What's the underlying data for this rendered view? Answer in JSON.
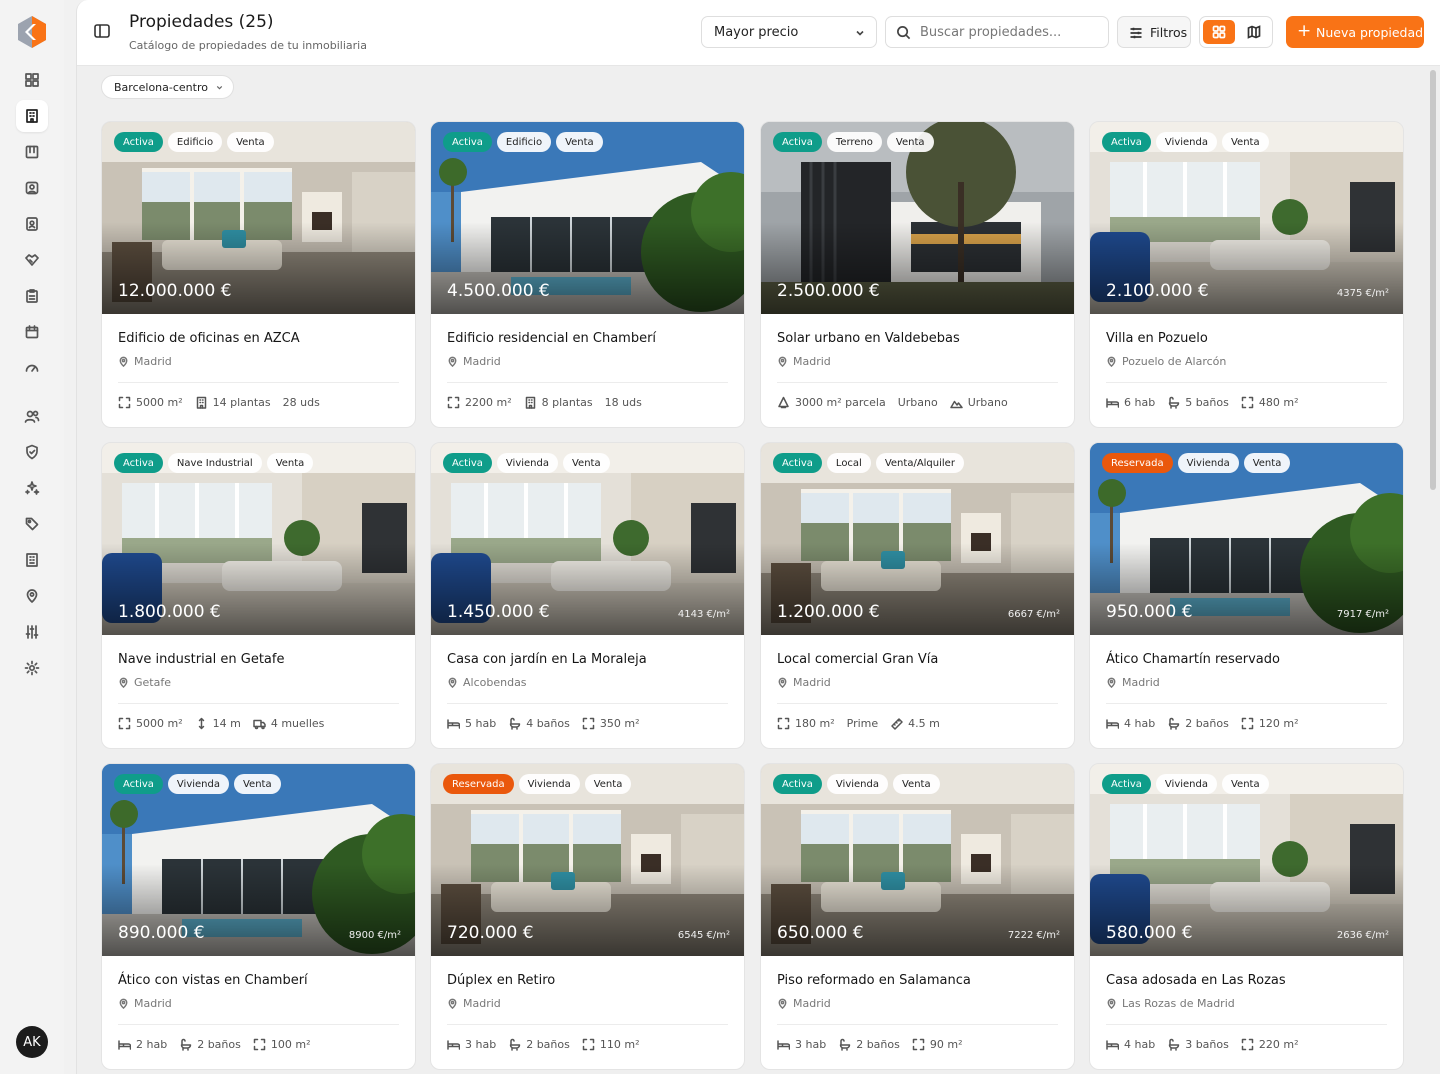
{
  "header": {
    "title": "Propiedades (25)",
    "subtitle": "Catálogo de propiedades de tu inmobiliaria",
    "sort_value": "Mayor precio",
    "search_placeholder": "Buscar propiedades...",
    "filters_label": "Filtros",
    "new_label": "Nueva propiedad"
  },
  "filters": {
    "location": "Barcelona-centro"
  },
  "user": {
    "initials": "AK"
  },
  "colors": {
    "accent": "#f97316",
    "active": "#0f9d8a",
    "reserved": "#ea580c"
  },
  "cards": [
    {
      "status": "Activa",
      "type": "Edificio",
      "op": "Venta",
      "price": "12.000.000 €",
      "per_m2": "",
      "title": "Edificio de oficinas en AZCA",
      "city": "Madrid",
      "scene": "interior",
      "specs": [
        {
          "icon": "area-icon",
          "text": "5000 m²"
        },
        {
          "icon": "building-icon",
          "text": "14 plantas"
        },
        {
          "icon": "",
          "text": "28 uds"
        }
      ]
    },
    {
      "status": "Activa",
      "type": "Edificio",
      "op": "Venta",
      "price": "4.500.000 €",
      "per_m2": "",
      "title": "Edificio residencial en Chamberí",
      "city": "Madrid",
      "scene": "villa",
      "specs": [
        {
          "icon": "area-icon",
          "text": "2200 m²"
        },
        {
          "icon": "building-icon",
          "text": "8 plantas"
        },
        {
          "icon": "",
          "text": "18 uds"
        }
      ]
    },
    {
      "status": "Activa",
      "type": "Terreno",
      "op": "Venta",
      "price": "2.500.000 €",
      "per_m2": "",
      "title": "Solar urbano en Valdebebas",
      "city": "Madrid",
      "scene": "modern",
      "specs": [
        {
          "icon": "parcel-icon",
          "text": "3000 m² parcela"
        },
        {
          "icon": "",
          "text": "Urbano"
        },
        {
          "icon": "mountain-icon",
          "text": "Urbano"
        }
      ]
    },
    {
      "status": "Activa",
      "type": "Vivienda",
      "op": "Venta",
      "price": "2.100.000 €",
      "per_m2": "4375 €/m²",
      "title": "Villa en Pozuelo",
      "city": "Pozuelo de Alarcón",
      "scene": "living",
      "specs": [
        {
          "icon": "bed-icon",
          "text": "6 hab"
        },
        {
          "icon": "bath-icon",
          "text": "5 baños"
        },
        {
          "icon": "area-icon",
          "text": "480 m²"
        }
      ]
    },
    {
      "status": "Activa",
      "type": "Nave Industrial",
      "op": "Venta",
      "price": "1.800.000 €",
      "per_m2": "",
      "title": "Nave industrial en Getafe",
      "city": "Getafe",
      "scene": "living",
      "specs": [
        {
          "icon": "area-icon",
          "text": "5000 m²"
        },
        {
          "icon": "height-icon",
          "text": "14 m"
        },
        {
          "icon": "truck-icon",
          "text": "4 muelles"
        }
      ]
    },
    {
      "status": "Activa",
      "type": "Vivienda",
      "op": "Venta",
      "price": "1.450.000 €",
      "per_m2": "4143 €/m²",
      "title": "Casa con jardín en La Moraleja",
      "city": "Alcobendas",
      "scene": "living",
      "specs": [
        {
          "icon": "bed-icon",
          "text": "5 hab"
        },
        {
          "icon": "bath-icon",
          "text": "4 baños"
        },
        {
          "icon": "area-icon",
          "text": "350 m²"
        }
      ]
    },
    {
      "status": "Activa",
      "type": "Local",
      "op": "Venta/Alquiler",
      "price": "1.200.000 €",
      "per_m2": "6667 €/m²",
      "title": "Local comercial Gran Vía",
      "city": "Madrid",
      "scene": "interior",
      "specs": [
        {
          "icon": "area-icon",
          "text": "180 m²"
        },
        {
          "icon": "",
          "text": "Prime"
        },
        {
          "icon": "ruler-icon",
          "text": "4.5 m"
        }
      ]
    },
    {
      "status": "Reservada",
      "type": "Vivienda",
      "op": "Venta",
      "price": "950.000 €",
      "per_m2": "7917 €/m²",
      "title": "Ático Chamartín reservado",
      "city": "Madrid",
      "scene": "villa",
      "specs": [
        {
          "icon": "bed-icon",
          "text": "4 hab"
        },
        {
          "icon": "bath-icon",
          "text": "2 baños"
        },
        {
          "icon": "area-icon",
          "text": "120 m²"
        }
      ]
    },
    {
      "status": "Activa",
      "type": "Vivienda",
      "op": "Venta",
      "price": "890.000 €",
      "per_m2": "8900 €/m²",
      "title": "Ático con vistas en Chamberí",
      "city": "Madrid",
      "scene": "villa",
      "specs": [
        {
          "icon": "bed-icon",
          "text": "2 hab"
        },
        {
          "icon": "bath-icon",
          "text": "2 baños"
        },
        {
          "icon": "area-icon",
          "text": "100 m²"
        }
      ]
    },
    {
      "status": "Reservada",
      "type": "Vivienda",
      "op": "Venta",
      "price": "720.000 €",
      "per_m2": "6545 €/m²",
      "title": "Dúplex en Retiro",
      "city": "Madrid",
      "scene": "interior",
      "specs": [
        {
          "icon": "bed-icon",
          "text": "3 hab"
        },
        {
          "icon": "bath-icon",
          "text": "2 baños"
        },
        {
          "icon": "area-icon",
          "text": "110 m²"
        }
      ]
    },
    {
      "status": "Activa",
      "type": "Vivienda",
      "op": "Venta",
      "price": "650.000 €",
      "per_m2": "7222 €/m²",
      "title": "Piso reformado en Salamanca",
      "city": "Madrid",
      "scene": "interior",
      "specs": [
        {
          "icon": "bed-icon",
          "text": "3 hab"
        },
        {
          "icon": "bath-icon",
          "text": "2 baños"
        },
        {
          "icon": "area-icon",
          "text": "90 m²"
        }
      ]
    },
    {
      "status": "Activa",
      "type": "Vivienda",
      "op": "Venta",
      "price": "580.000 €",
      "per_m2": "2636 €/m²",
      "title": "Casa adosada en Las Rozas",
      "city": "Las Rozas de Madrid",
      "scene": "living",
      "specs": [
        {
          "icon": "bed-icon",
          "text": "4 hab"
        },
        {
          "icon": "bath-icon",
          "text": "3 baños"
        },
        {
          "icon": "area-icon",
          "text": "220 m²"
        }
      ]
    }
  ]
}
